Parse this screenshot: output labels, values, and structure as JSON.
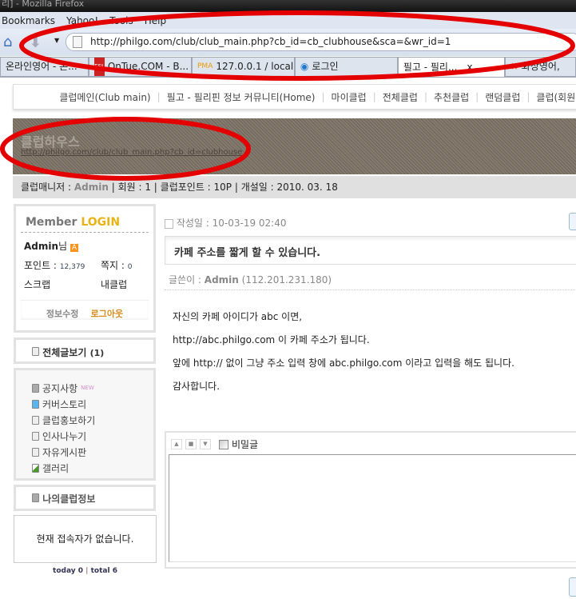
{
  "window": {
    "title": "리] - Mozilla Firefox"
  },
  "menubar": [
    "Bookmarks",
    "Yahoo!",
    "Tools",
    "Help"
  ],
  "address": {
    "url": "http://philgo.com/club/club_main.php?cb_id=cb_clubhouse&sca=&wr_id=1"
  },
  "tabs": [
    {
      "label": "온라인영어 - 온..."
    },
    {
      "label": "OnTue.COM - B..."
    },
    {
      "label": "127.0.0.1 / local..."
    },
    {
      "label": "로그인"
    },
    {
      "label": "필고 - 필리...",
      "close": "x"
    },
    {
      "label": "화상영어,"
    }
  ],
  "topnav": [
    "클럽메인(Club main)",
    "필고 - 필리핀 정보 커뮤니티(Home)",
    "마이클럽",
    "전체클럽",
    "추천클럽",
    "랜덤클럽",
    "클럽(회원수)"
  ],
  "banner": {
    "title": "클럽하우스",
    "url": "http://philgo.com/club/club_main.php?cb_id=clubhouse"
  },
  "info": {
    "manager_label": "클럽매니저 : ",
    "manager": "Admin",
    "members": " | 회원 : 1 | 클럽포인트 : 10P | 개설일 : 2010. 03. 18"
  },
  "member": {
    "title1": "Member",
    "title2": "LOGIN",
    "name": "Admin",
    "suffix": "님",
    "badge": "A",
    "points_label": "포인트 :",
    "points": "12,379",
    "memo_label": "쪽지 :",
    "memo": "0",
    "scrap": "스크랩",
    "myclub": "내클럽",
    "edit": "정보수정",
    "logout": "로그아웃"
  },
  "all_posts": {
    "label": "전체글보기",
    "count": "(1)"
  },
  "boards": [
    {
      "label": "공지사항",
      "new": "NEW"
    },
    {
      "label": "커버스토리"
    },
    {
      "label": "클럽홍보하기"
    },
    {
      "label": "인사나누기"
    },
    {
      "label": "자유게시판"
    },
    {
      "label": "갤러리"
    }
  ],
  "myclub_info": "나의클럽정보",
  "visitors": "현재 접속자가 없습니다.",
  "counter": {
    "today": "today 0",
    "total": "total 6"
  },
  "post": {
    "date_label": "작성일 : ",
    "date": "10-03-19 02:40",
    "title": "카페 주소를 짧게 할 수 있습니다.",
    "author_label": "글쓴이 : ",
    "author": "Admin",
    "ip": "(112.201.231.180)",
    "body": [
      "자신의 카페 아이디가 abc 이면,",
      "http://abc.philgo.com 이 카페 주소가 됩니다.",
      "앞에 http:// 없이 그냥 주소 입력 창에 abc.philgo.com 이라고 입력을 해도 됩니다.",
      "감사합니다."
    ]
  },
  "comment": {
    "secret": "비밀글"
  }
}
